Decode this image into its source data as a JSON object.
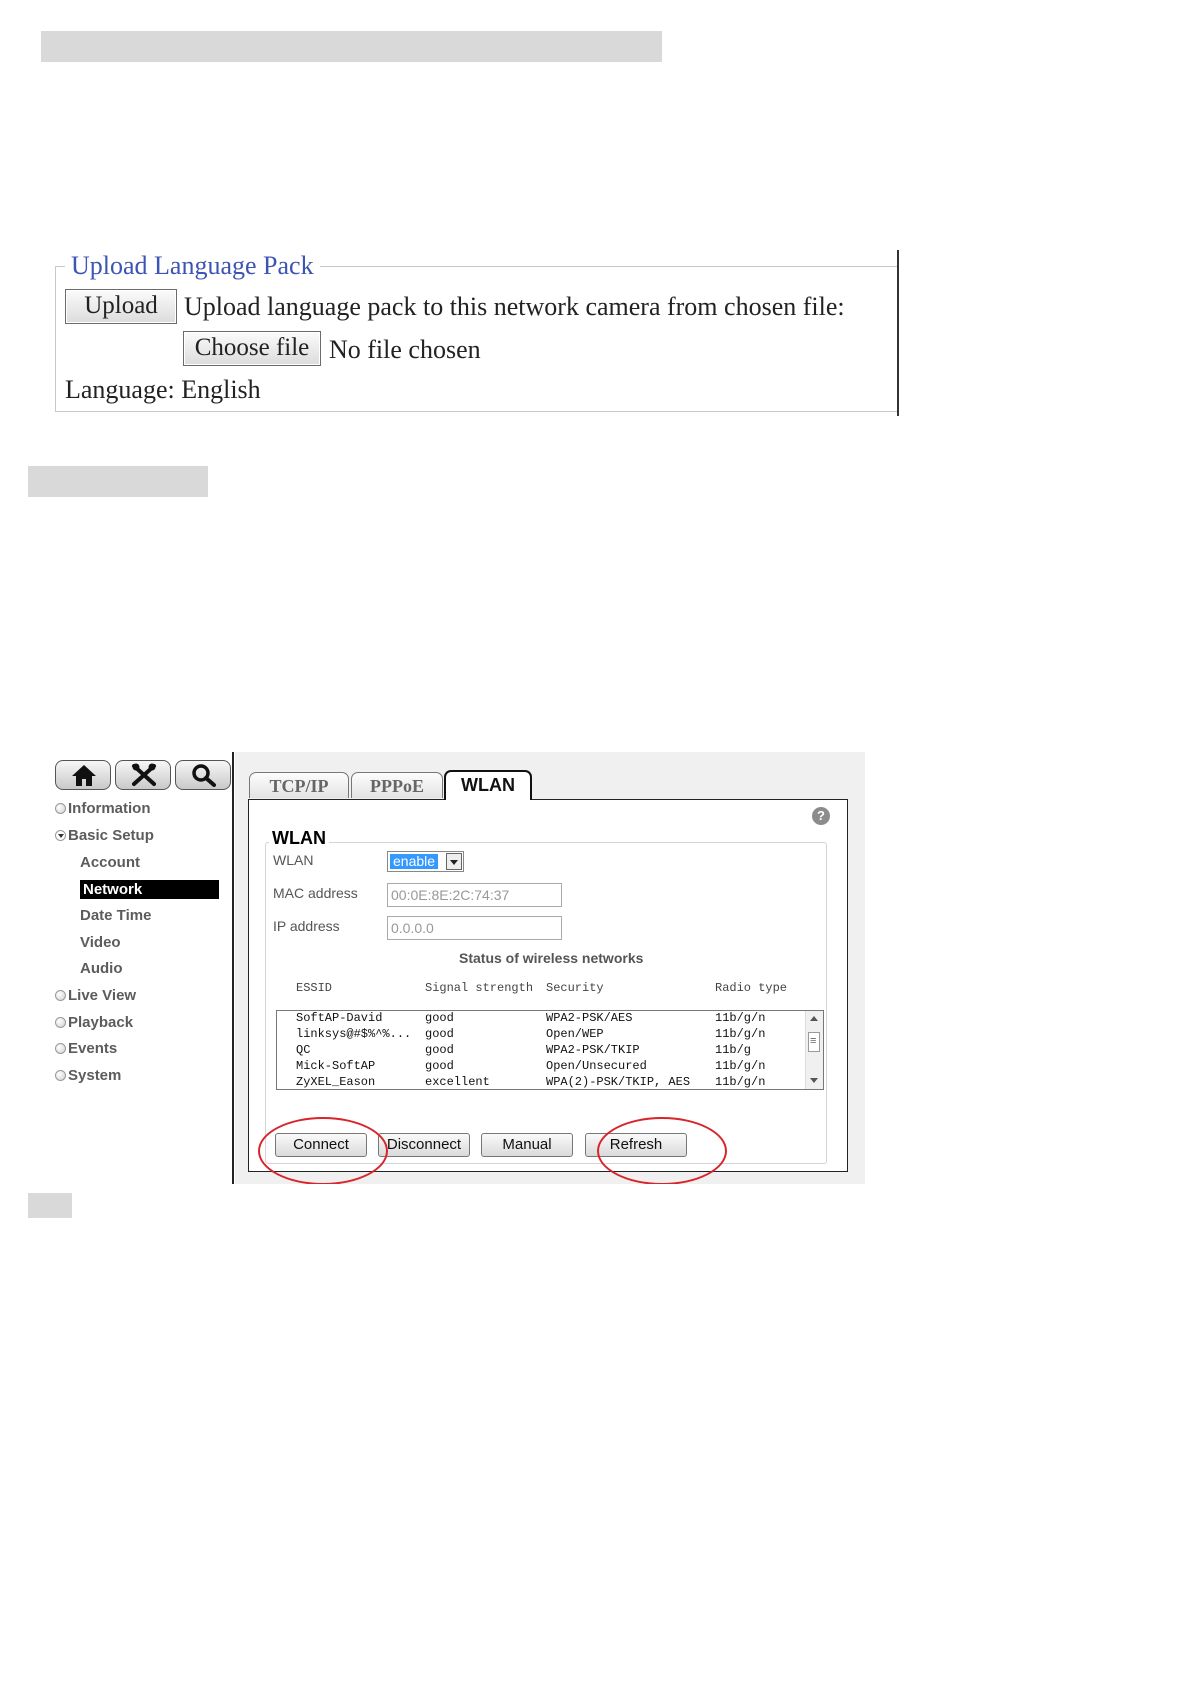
{
  "language_pack": {
    "legend": "Upload Language Pack",
    "upload_label": "Upload",
    "upload_description": "Upload language pack to this network camera from chosen file:",
    "choose_file_label": "Choose file",
    "file_status": "No file chosen",
    "language_line": "Language: English"
  },
  "camera_ui": {
    "toolbar": [
      "home-icon",
      "tools-icon",
      "search-icon"
    ],
    "sidebar": {
      "information": "Information",
      "basic_setup": "Basic Setup",
      "sub_items": [
        "Account",
        "Network",
        "Date Time",
        "Video",
        "Audio"
      ],
      "active_sub_item": "Network",
      "live_view": "Live View",
      "playback": "Playback",
      "events": "Events",
      "system": "System"
    },
    "tabs": [
      "TCP/IP",
      "PPPoE",
      "WLAN"
    ],
    "active_tab": "WLAN",
    "wlan": {
      "legend": "WLAN",
      "wlan_label": "WLAN",
      "wlan_value": "enable",
      "mac_label": "MAC address",
      "mac_value": "00:0E:8E:2C:74:37",
      "ip_label": "IP address",
      "ip_value": "0.0.0.0",
      "status_title": "Status of wireless networks",
      "columns": [
        "ESSID",
        "Signal strength",
        "Security",
        "Radio type"
      ],
      "networks": [
        [
          "SoftAP-David",
          "good",
          "WPA2-PSK/AES",
          "11b/g/n"
        ],
        [
          "linksys@#$%^%...",
          "good",
          "Open/WEP",
          "11b/g/n"
        ],
        [
          "QC",
          "good",
          "WPA2-PSK/TKIP",
          "11b/g"
        ],
        [
          "Mick-SoftAP",
          "good",
          "Open/Unsecured",
          "11b/g/n"
        ],
        [
          "ZyXEL_Eason",
          "excellent",
          "WPA(2)-PSK/TKIP, AES",
          "11b/g/n"
        ]
      ],
      "buttons": {
        "connect": "Connect",
        "disconnect": "Disconnect",
        "manual": "Manual",
        "refresh": "Refresh"
      },
      "highlight_color": "#d8252b"
    }
  }
}
